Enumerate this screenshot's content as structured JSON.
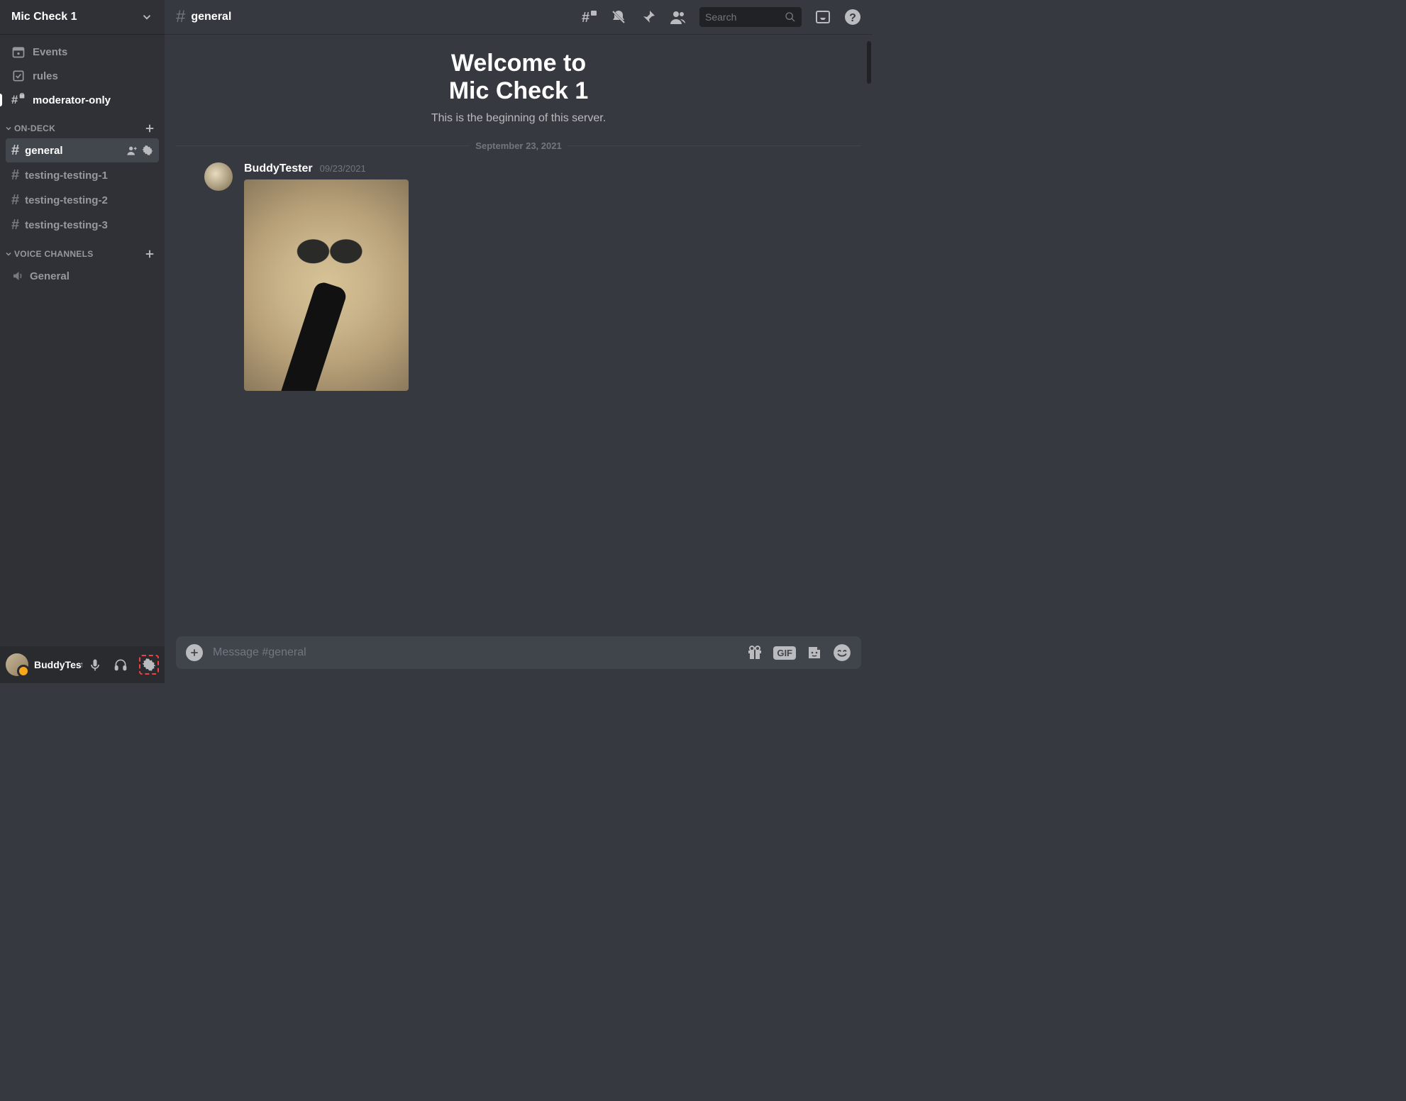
{
  "server": {
    "name": "Mic Check 1"
  },
  "sidebar": {
    "events": "Events",
    "rules": "rules",
    "moderator": "moderator-only",
    "categories": [
      {
        "label": "ON-DECK",
        "channels": [
          {
            "name": "general",
            "selected": true
          },
          {
            "name": "testing-testing-1"
          },
          {
            "name": "testing-testing-2"
          },
          {
            "name": "testing-testing-3"
          }
        ]
      },
      {
        "label": "VOICE CHANNELS",
        "voiceChannels": [
          {
            "name": "General"
          }
        ]
      }
    ]
  },
  "userPanel": {
    "name": "BuddyTester"
  },
  "topBar": {
    "channel": "general",
    "searchPlaceholder": "Search"
  },
  "welcome": {
    "line1": "Welcome to",
    "line2": "Mic Check 1",
    "subtitle": "This is the beginning of this server."
  },
  "dateDivider": "September 23, 2021",
  "message": {
    "author": "BuddyTester",
    "timestamp": "09/23/2021"
  },
  "composer": {
    "placeholder": "Message #general",
    "gifLabel": "GIF"
  }
}
